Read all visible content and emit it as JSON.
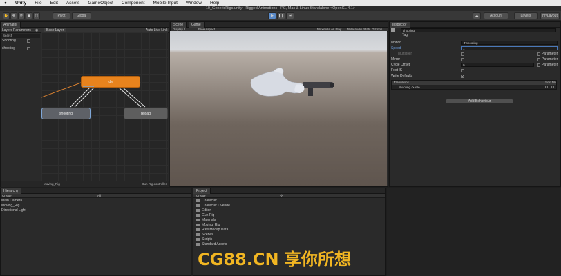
{
  "menubar": {
    "apple": "",
    "items": [
      "Unity",
      "File",
      "Edit",
      "Assets",
      "GameObject",
      "Component",
      "Mobile Input",
      "Window",
      "Help"
    ]
  },
  "window_title": "10_GenericRigs.unity - Rigged Animations - PC, Mac & Linux Standalone <OpenGL 4.1>",
  "toolbar": {
    "pivot": "Pivot",
    "global": "Global",
    "account": "Account",
    "layers": "Layers",
    "layout": "myLayout"
  },
  "animator": {
    "tab": "Animator",
    "sub_tabs": [
      "Layers",
      "Parameters"
    ],
    "breadcrumb": "Base Layer",
    "auto_live": "Auto Live Link",
    "search_placeholder": "Search",
    "params": [
      {
        "name": "Shooting"
      },
      {
        "name": "shooting"
      }
    ],
    "states": {
      "idle": "Idle",
      "shooting": "shooting",
      "reload": "reload"
    },
    "footer_left": "Moving_Rig",
    "footer_right": "Gun Rig.controller"
  },
  "scene": {
    "tabs": [
      "Scene",
      "Game"
    ],
    "display": "Display 1",
    "aspect": "Free Aspect",
    "options": [
      "Maximize on Play",
      "Mute audio",
      "Stats",
      "Gizmos"
    ]
  },
  "inspector": {
    "tab": "Inspector",
    "state_name": "shooting",
    "tag_label": "Tag",
    "rows": [
      {
        "label": "Motion",
        "value": "shooting"
      },
      {
        "label": "Speed",
        "value": "1"
      },
      {
        "label": "Multiplier",
        "value": ""
      },
      {
        "label": "Mirror",
        "value": ""
      },
      {
        "label": "Cycle Offset",
        "value": "0"
      },
      {
        "label": "Foot IK",
        "value": ""
      },
      {
        "label": "Write Defaults",
        "value": ""
      }
    ],
    "parameter_label": "Parameter",
    "transitions_label": "Transitions",
    "transitions_cols": [
      "Solo",
      "Mu"
    ],
    "transition": "shooting -> idle",
    "add_behaviour": "Add Behaviour"
  },
  "hierarchy": {
    "tab": "Hierarchy",
    "create": "Create",
    "search": "All",
    "items": [
      "Main Camera",
      "Moving_Rig",
      "Directional Light"
    ]
  },
  "project": {
    "tab": "Project",
    "create": "Create",
    "items": [
      "Character",
      "Character Overide",
      "Editor",
      "Gun Rig",
      "Materials",
      "Moving_Rig",
      "Raw Mocap Data",
      "Scenes",
      "Scripts",
      "Standard Assets"
    ]
  },
  "watermark": "CG88.CN 享你所想"
}
